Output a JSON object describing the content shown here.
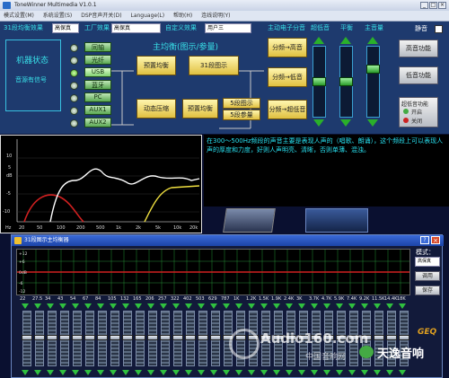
{
  "window": {
    "title": "ToneWinner Multimedia V1.0.1"
  },
  "menu": [
    "模式设置(M)",
    "系统设置(S)",
    "DSP音声开关(D)",
    "Language(L)",
    "帮助(H)",
    "连线说明(Y)"
  ],
  "top": {
    "eq31_label": "31段均衡效果",
    "eq31_value": "高保真",
    "factory_label": "工厂效果",
    "factory_value": "高保真",
    "custom_label": "自定义效果",
    "custom_value": "用户三"
  },
  "headers": {
    "master_freq": "主动电子分音",
    "sub": "超低音",
    "balance": "平衡",
    "volume": "主音量",
    "mute": "静音"
  },
  "machine": {
    "title": "机器状态",
    "signal": "音源有信号"
  },
  "inputs": [
    "同轴",
    "光纤",
    "USB",
    "蓝牙",
    "PC",
    "AUX1",
    "AUX2"
  ],
  "eq_diagram": {
    "title": "主均衡(图示/参量)",
    "preset_eq": "预置均衡",
    "eq31_view": "31段图示",
    "compress": "动态压缩",
    "preset_eq2": "预置均衡",
    "view5": "5段图示",
    "param5": "5段参量"
  },
  "crossover": {
    "high": "分频→高音",
    "low": "分频→低音",
    "sub": "分频→超低音"
  },
  "right_buttons": {
    "tweeter": "高音功能",
    "bass": "低音功能",
    "shunt": "超低音功能",
    "hp_on": "开启",
    "hp_off": "关闭"
  },
  "graph": {
    "y_ticks": [
      "10",
      "5",
      "dB",
      "-5",
      "-10"
    ],
    "x_ticks": [
      "20",
      "50",
      "100",
      "200",
      "500",
      "1k",
      "2k",
      "5k",
      "10k",
      "20k"
    ],
    "x_unit": "Hz"
  },
  "description": "在300～500Hz频段的声音主要是表现人声的（唱歌、朗诵），这个频段上可以表现人声的厚度和力度，好则人声明亮、清晰，否则单薄、混浊。",
  "eq_window": {
    "title": "31段图示主均衡器",
    "mode_label": "模式：",
    "mode_value": "高保真",
    "apply": "调用",
    "save": "保存",
    "db_ticks": [
      "+12",
      "+6",
      "0dB",
      "-6",
      "-12"
    ]
  },
  "eq_bands": [
    "22",
    "27.5",
    "34",
    "43",
    "54",
    "67",
    "84",
    "105",
    "132",
    "165",
    "206",
    "257",
    "322",
    "402",
    "503",
    "629",
    "787",
    "1K",
    "1.2K",
    "1.5K",
    "1.9K",
    "2.4K",
    "3K",
    "3.7K",
    "4.7K",
    "5.9K",
    "7.4K",
    "9.2K",
    "11.5K",
    "14.4K",
    "18K"
  ],
  "watermark": {
    "site": "Audio160.com",
    "cn": "中国音响网",
    "brand": "天逸音响"
  },
  "colors": {
    "panel_bg": "#1e3a6e",
    "accent_cyan": "#38e0e8",
    "title_blue": "#1c44a8",
    "red_line": "#d02020",
    "eq_green": "#30c040"
  }
}
